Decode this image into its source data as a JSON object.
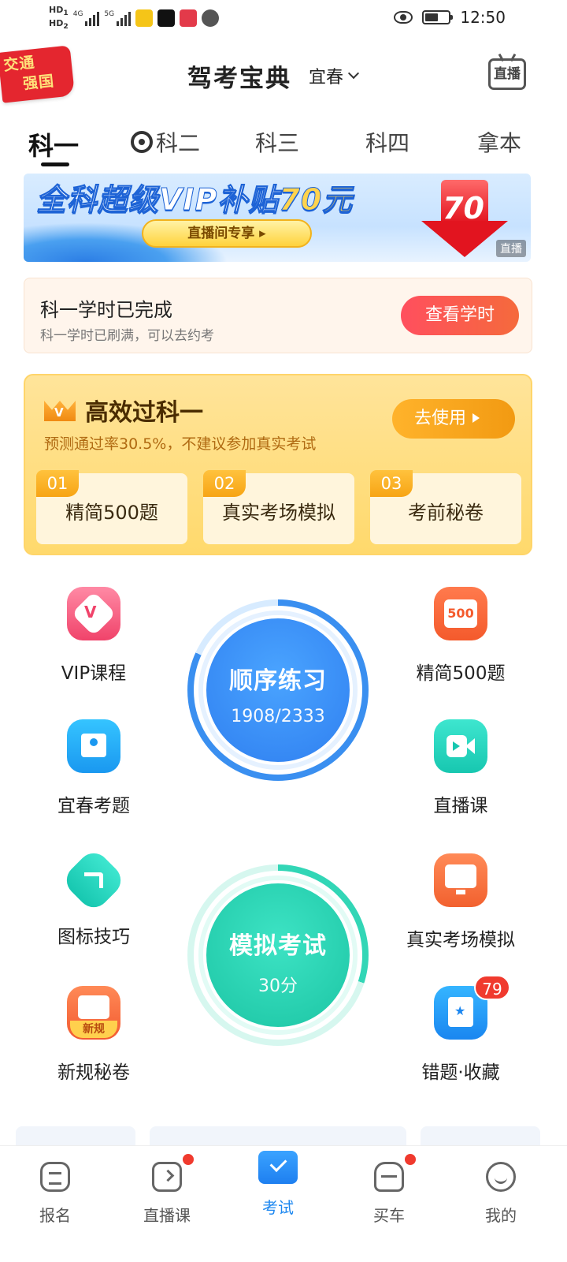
{
  "status_bar": {
    "hd1": "HD",
    "hd1_sub": "1",
    "hd2": "HD",
    "hd2_sub": "2",
    "net1": "4G",
    "net2": "5G",
    "time": "12:50"
  },
  "header": {
    "badge_text_line1": "交通",
    "badge_text_line2": "强国",
    "title": "驾考宝典",
    "city": "宜春",
    "live_button": "直播"
  },
  "tabs": [
    {
      "label": "科一",
      "active": true
    },
    {
      "label": "科二",
      "active": false
    },
    {
      "label": "科三",
      "active": false
    },
    {
      "label": "科四",
      "active": false
    },
    {
      "label": "拿本",
      "active": false
    }
  ],
  "banner": {
    "title_prefix": "全科超级VIP补贴",
    "title_amount": "70元",
    "button": "直播间专享",
    "arrow_amount": "70",
    "tag": "直播"
  },
  "hours_card": {
    "title": "科一学时已完成",
    "subtitle": "科一学时已刷满，可以去约考",
    "button": "查看学时"
  },
  "pass_card": {
    "title": "高效过科一",
    "crown_letter": "V",
    "subtitle": "预测通过率30.5%，不建议参加真实考试",
    "button": "去使用",
    "items": [
      {
        "no": "01",
        "label": "精简500题"
      },
      {
        "no": "02",
        "label": "真实考场模拟"
      },
      {
        "no": "03",
        "label": "考前秘卷"
      }
    ]
  },
  "features": {
    "vip": {
      "label": "VIP课程",
      "icon": "vip-course-icon"
    },
    "jingjian": {
      "label": "精简500题",
      "icon_text": "500"
    },
    "city_exam": {
      "label": "宜春考题",
      "icon": "map-pin-icon"
    },
    "live_class": {
      "label": "直播课",
      "icon": "video-camera-icon"
    },
    "sign_tips": {
      "label": "图标技巧",
      "icon": "road-sign-icon"
    },
    "real_exam": {
      "label": "真实考场模拟",
      "icon": "monitor-icon"
    },
    "new_rules": {
      "label": "新规秘卷",
      "icon_tag": "新规"
    },
    "wrong_fav": {
      "label": "错题·收藏",
      "badge": "79"
    }
  },
  "practice": {
    "title": "顺序练习",
    "progress": "1908/2333",
    "progress_fraction": 0.818
  },
  "mock_exam": {
    "title": "模拟考试",
    "score": "30分",
    "progress_fraction": 0.3
  },
  "bottom_nav": [
    {
      "label": "报名",
      "active": false,
      "dot": false
    },
    {
      "label": "直播课",
      "active": false,
      "dot": true
    },
    {
      "label": "考试",
      "active": true,
      "dot": false
    },
    {
      "label": "买车",
      "active": false,
      "dot": true
    },
    {
      "label": "我的",
      "active": false,
      "dot": false
    }
  ],
  "colors": {
    "accent_blue": "#2f7ff0",
    "accent_green": "#1cc5a4",
    "badge_red": "#f03a2e",
    "pass_card_yellow": "#ffd96c"
  }
}
